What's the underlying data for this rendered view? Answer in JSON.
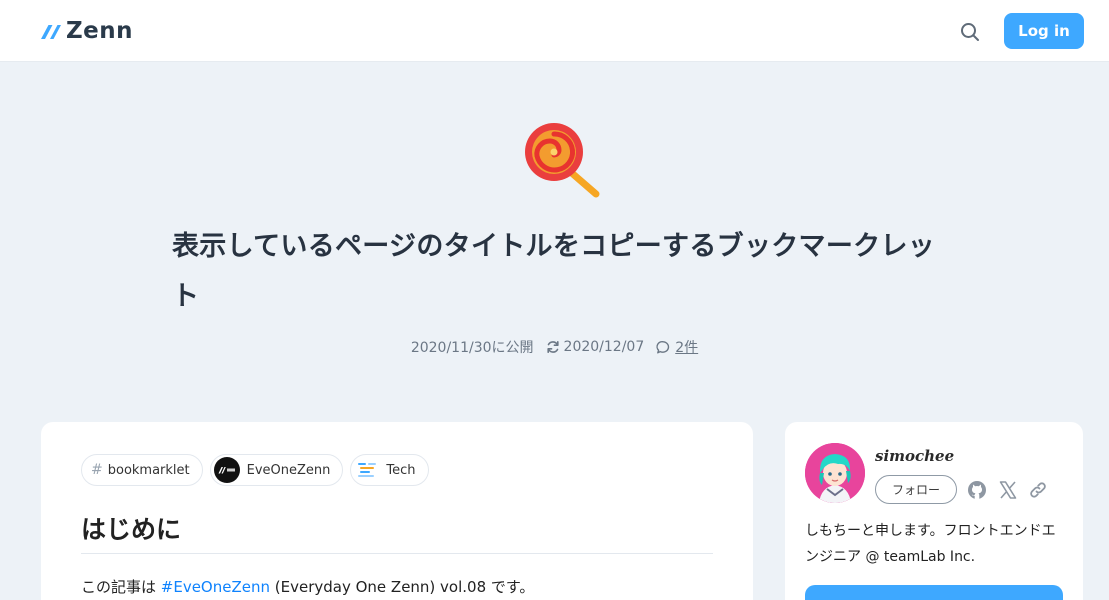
{
  "header": {
    "logo_text": "Zenn",
    "search_icon": "search-icon",
    "login_label": "Log in"
  },
  "article": {
    "emoji": "lollipop",
    "title": "表示しているページのタイトルをコピーするブックマークレット",
    "published": "2020/11/30に公開",
    "updated": "2020/12/07",
    "comments": "2件",
    "topics": [
      {
        "label": "bookmarklet",
        "icon": "hash-icon"
      },
      {
        "label": "EveOneZenn",
        "icon": "zenn-logo"
      },
      {
        "label": "Tech",
        "icon": "tech-icon"
      }
    ],
    "heading": "はじめに",
    "intro_prefix": "この記事は ",
    "intro_link": "#EveOneZenn",
    "intro_suffix": " (Everyday One Zenn) vol.08 です。"
  },
  "profile": {
    "name": "simochee",
    "follow_label": "フォロー",
    "bio": "しもちーと申します。フロントエンドエンジニア @ teamLab Inc.",
    "social_icons": [
      "github-icon",
      "x-icon",
      "link-icon"
    ]
  },
  "colors": {
    "accent": "#3ea8ff",
    "link": "#0f83fd",
    "background": "#edf2f7"
  }
}
